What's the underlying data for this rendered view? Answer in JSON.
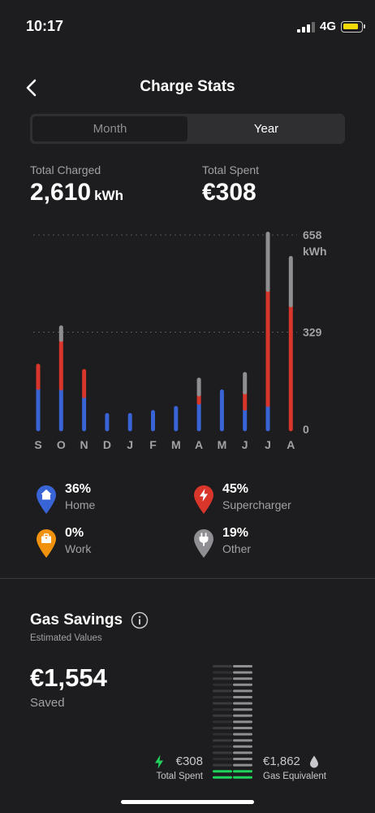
{
  "status_bar": {
    "time": "10:17",
    "network": "4G"
  },
  "header": {
    "title": "Charge Stats"
  },
  "segments": {
    "month": "Month",
    "year": "Year",
    "selected": "Year"
  },
  "totals": {
    "charged_label": "Total Charged",
    "charged_value": "2,610",
    "charged_unit": "kWh",
    "spent_label": "Total Spent",
    "spent_value": "€308"
  },
  "colors": {
    "home": "#3864d6",
    "supercharger": "#d8352b",
    "work": "#f0920e",
    "other": "#8e8e93",
    "gas_green": "#1fd35c"
  },
  "chart_data": {
    "type": "bar",
    "stacked": true,
    "categories": [
      "S",
      "O",
      "N",
      "D",
      "J",
      "F",
      "M",
      "A",
      "M",
      "J",
      "J",
      "A"
    ],
    "ylim": [
      0,
      658
    ],
    "y_ticks": [
      0,
      329,
      658
    ],
    "y_tick_labels": [
      "0",
      "329",
      "658"
    ],
    "y_unit": "kWh",
    "grid": true,
    "series": [
      {
        "name": "Home",
        "values": [
          140,
          138,
          112,
          48,
          48,
          58,
          72,
          90,
          128,
          70,
          82,
          0
        ]
      },
      {
        "name": "Supercharger",
        "values": [
          75,
          165,
          85,
          0,
          0,
          0,
          0,
          28,
          0,
          55,
          390,
          420
        ]
      },
      {
        "name": "Work",
        "values": [
          0,
          0,
          0,
          0,
          0,
          0,
          0,
          0,
          0,
          0,
          0,
          0
        ]
      },
      {
        "name": "Other",
        "values": [
          0,
          42,
          0,
          0,
          0,
          0,
          0,
          50,
          0,
          62,
          190,
          160
        ]
      }
    ]
  },
  "legend": [
    {
      "percent": "36%",
      "label": "Home"
    },
    {
      "percent": "45%",
      "label": "Supercharger"
    },
    {
      "percent": "0%",
      "label": "Work"
    },
    {
      "percent": "19%",
      "label": "Other"
    }
  ],
  "gas": {
    "title": "Gas Savings",
    "subtitle": "Estimated Values",
    "saved_value": "€1,554",
    "saved_label": "Saved",
    "spent_value": "€308",
    "spent_label": "Total Spent",
    "gas_value": "€1,862",
    "gas_label": "Gas Equivalent",
    "spent_fraction": 0.165
  }
}
